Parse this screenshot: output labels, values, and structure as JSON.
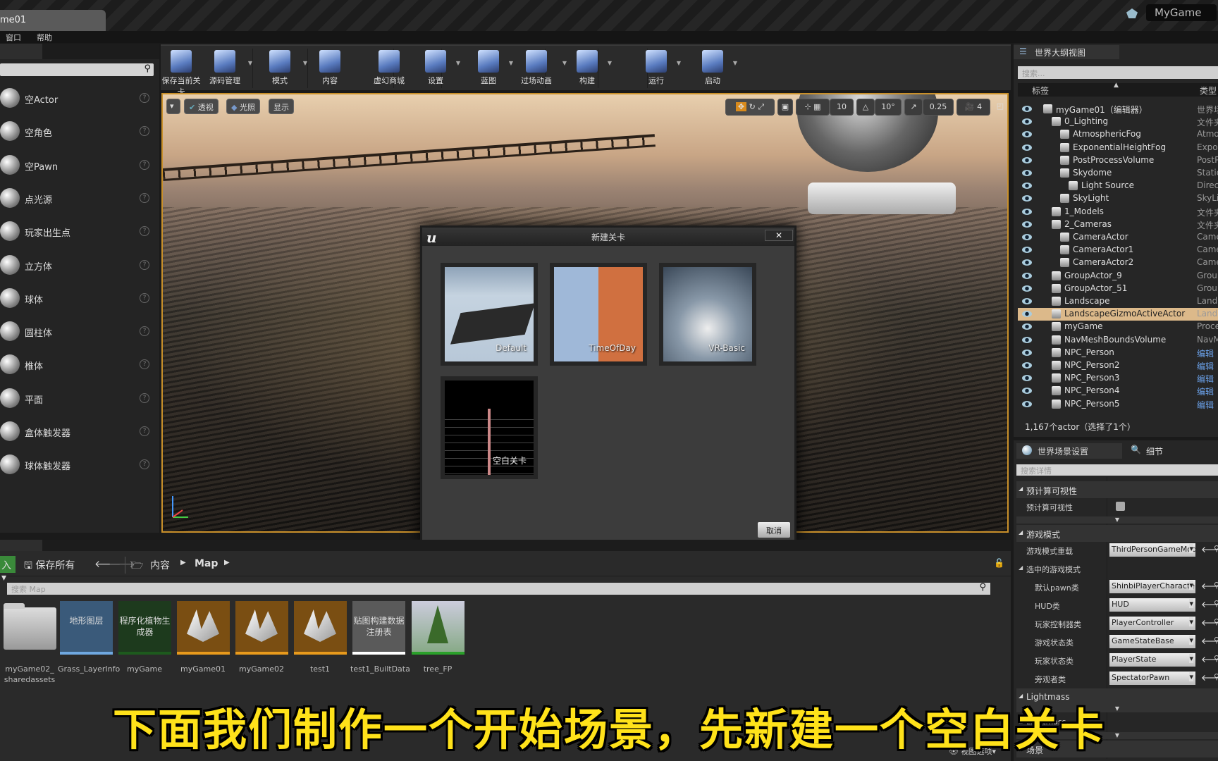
{
  "window": {
    "doc_tab": "me01",
    "project": "MyGame"
  },
  "menu": [
    "窗口",
    "帮助"
  ],
  "place_items": [
    "空Actor",
    "空角色",
    "空Pawn",
    "点光源",
    "玩家出生点",
    "立方体",
    "球体",
    "圆柱体",
    "椎体",
    "平面",
    "盒体触发器",
    "球体触发器"
  ],
  "toolbar": [
    {
      "label": "保存当前关卡",
      "icon": "save-icon",
      "dd": false
    },
    {
      "label": "源码管理",
      "icon": "source-control-icon",
      "dd": true
    },
    {
      "label": "模式",
      "icon": "modes-icon",
      "dd": true
    },
    {
      "label": "内容",
      "icon": "content-icon",
      "dd": false
    },
    {
      "label": "虚幻商城",
      "icon": "marketplace-icon",
      "dd": false
    },
    {
      "label": "设置",
      "icon": "settings-icon",
      "dd": true
    },
    {
      "label": "蓝图",
      "icon": "blueprint-icon",
      "dd": true
    },
    {
      "label": "过场动画",
      "icon": "cinematics-icon",
      "dd": true
    },
    {
      "label": "构建",
      "icon": "build-icon",
      "dd": true
    },
    {
      "label": "运行",
      "icon": "play-icon",
      "dd": true
    },
    {
      "label": "启动",
      "icon": "launch-icon",
      "dd": true
    }
  ],
  "viewport": {
    "left_buttons": [
      "透视",
      "光照",
      "显示"
    ],
    "grid_snap": "10",
    "rotation_snap": "10°",
    "scale_snap": "0.25",
    "camera_speed": "4"
  },
  "dialog": {
    "title": "新建关卡",
    "templates": [
      "Default",
      "TimeOfDay",
      "VR-Basic",
      "空白关卡"
    ],
    "cancel": "取消"
  },
  "outliner": {
    "tab": "世界大纲视图",
    "search_placeholder": "搜索...",
    "col_label": "标签",
    "col_type": "类型",
    "rows": [
      {
        "name": "myGame01（编辑器）",
        "type": "世界场",
        "indent": 1
      },
      {
        "name": "0_Lighting",
        "type": "文件夹",
        "indent": 2
      },
      {
        "name": "AtmosphericFog",
        "type": "Atmo",
        "indent": 3
      },
      {
        "name": "ExponentialHeightFog",
        "type": "Expo",
        "indent": 3
      },
      {
        "name": "PostProcessVolume",
        "type": "PostP",
        "indent": 3
      },
      {
        "name": "Skydome",
        "type": "Static",
        "indent": 3
      },
      {
        "name": "Light Source",
        "type": "Direct",
        "indent": 4
      },
      {
        "name": "SkyLight",
        "type": "SkyLi",
        "indent": 3
      },
      {
        "name": "1_Models",
        "type": "文件夹",
        "indent": 2
      },
      {
        "name": "2_Cameras",
        "type": "文件夹",
        "indent": 2
      },
      {
        "name": "CameraActor",
        "type": "Came",
        "indent": 3
      },
      {
        "name": "CameraActor1",
        "type": "Came",
        "indent": 3
      },
      {
        "name": "CameraActor2",
        "type": "Came",
        "indent": 3
      },
      {
        "name": "GroupActor_9",
        "type": "Group",
        "indent": 2
      },
      {
        "name": "GroupActor_51",
        "type": "Group",
        "indent": 2
      },
      {
        "name": "Landscape",
        "type": "Land",
        "indent": 2
      },
      {
        "name": "LandscapeGizmoActiveActor",
        "type": "Land",
        "indent": 2,
        "selected": true
      },
      {
        "name": "myGame",
        "type": "Proce",
        "indent": 2
      },
      {
        "name": "NavMeshBoundsVolume",
        "type": "NavM",
        "indent": 2
      },
      {
        "name": "NPC_Person",
        "type": "编辑",
        "indent": 2,
        "link": true
      },
      {
        "name": "NPC_Person2",
        "type": "编辑",
        "indent": 2,
        "link": true
      },
      {
        "name": "NPC_Person3",
        "type": "编辑",
        "indent": 2,
        "link": true
      },
      {
        "name": "NPC_Person4",
        "type": "编辑",
        "indent": 2,
        "link": true
      },
      {
        "name": "NPC_Person5",
        "type": "编辑",
        "indent": 2,
        "link": true
      }
    ],
    "footer": "1,167个actor（选择了1个）"
  },
  "details": {
    "tab_world": "世界场景设置",
    "tab_details": "细节",
    "search_placeholder": "搜索详情",
    "rows": [
      {
        "key": "预计算可视性",
        "cat": true
      },
      {
        "key": "预计算可视性",
        "checkbox": true
      },
      {
        "key": "游戏模式",
        "cat": true
      },
      {
        "key": "游戏模式重载",
        "value": "ThirdPersonGameMode"
      },
      {
        "key": "选中的游戏模式",
        "sub": true
      },
      {
        "key": "默认pawn类",
        "value": "ShinbiPlayerCharacter"
      },
      {
        "key": "HUD类",
        "value": "HUD"
      },
      {
        "key": "玩家控制器类",
        "value": "PlayerController"
      },
      {
        "key": "游戏状态类",
        "value": "GameStateBase"
      },
      {
        "key": "玩家状态类",
        "value": "PlayerState"
      },
      {
        "key": "旁观者类",
        "value": "SpectatorPawn"
      },
      {
        "key": "Lightmass",
        "cat": true
      },
      {
        "key": "Lightmass",
        "sub": true
      },
      {
        "key": "场景",
        "cat": true
      }
    ]
  },
  "content_browser": {
    "add_label": "入",
    "save_all": "保存所有",
    "path": [
      "内容",
      "Map"
    ],
    "search_placeholder": "搜索 Map",
    "view_options": "视图选项",
    "assets": [
      {
        "name": "myGame02_\nsharedassets",
        "type": "folder",
        "thumb": "",
        "color": "#9a9a9a"
      },
      {
        "name": "Grass_LayerInfo",
        "type": "layerinfo",
        "thumb": "地形图层",
        "color": "#6fa8e0"
      },
      {
        "name": "myGame",
        "type": "foliage",
        "thumb": "程序化植物生成器",
        "color": "#1d5a1d"
      },
      {
        "name": "myGame01",
        "type": "level",
        "thumb": "",
        "color": "#e89a1c"
      },
      {
        "name": "myGame02",
        "type": "level",
        "thumb": "",
        "color": "#e89a1c"
      },
      {
        "name": "test1",
        "type": "level",
        "thumb": "",
        "color": "#e89a1c"
      },
      {
        "name": "test1_BuiltData",
        "type": "builtdata",
        "thumb": "贴图构建数据注册表",
        "color": "#ffffff"
      },
      {
        "name": "tree_FP",
        "type": "mesh",
        "thumb": "",
        "color": "#2aa02a"
      }
    ]
  },
  "subtitle": "下面我们制作一个开始场景，先新建一个空白关卡"
}
